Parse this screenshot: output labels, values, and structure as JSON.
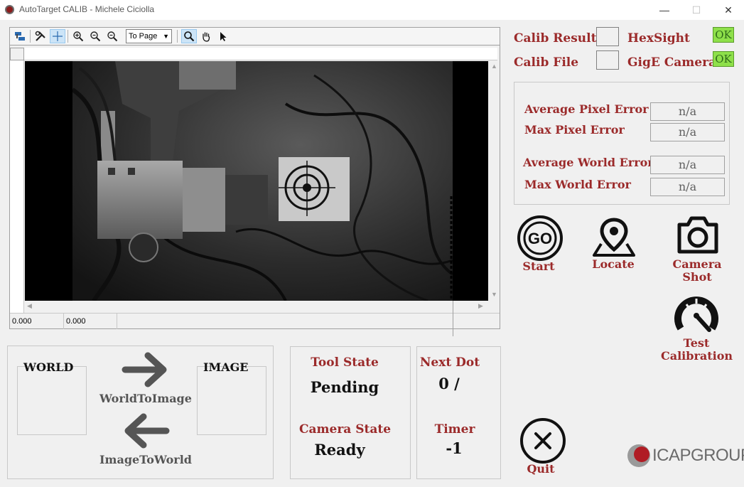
{
  "window": {
    "title": "AutoTarget CALIB - Michele Ciciolla",
    "minimize_glyph": "—",
    "maximize_glyph": "☐",
    "close_glyph": "✕"
  },
  "toolbar": {
    "zoom_mode": "To Page",
    "icons": [
      "layers-icon",
      "tools-icon",
      "crosshair-icon",
      "zoom-fit-icon",
      "zoom-in-icon",
      "zoom-out-icon",
      "magnifier-icon",
      "hand-icon",
      "pointer-icon"
    ]
  },
  "viewer": {
    "status_x": "0.000",
    "status_y": "0.000"
  },
  "status": {
    "calib_result_label": "Calib Result",
    "calib_file_label": "Calib File",
    "hexsight_label": "HexSight",
    "hexsight_value": "OK",
    "gige_label": "GigE Camera",
    "gige_value": "OK",
    "ok_color": "#8ee04a"
  },
  "errors": {
    "avg_pixel_label": "Average Pixel Error",
    "avg_pixel_value": "n/a",
    "max_pixel_label": "Max Pixel Error",
    "max_pixel_value": "n/a",
    "avg_world_label": "Average World Error",
    "avg_world_value": "n/a",
    "max_world_label": "Max World Error",
    "max_world_value": "n/a"
  },
  "actions": {
    "go_icon_text": "GO",
    "start_label": "Start",
    "locate_label": "Locate",
    "camera_shot_label_1": "Camera",
    "camera_shot_label_2": "Shot",
    "test_calibration_label_1": "Test",
    "test_calibration_label_2": "Calibration",
    "quit_label": "Quit"
  },
  "transform": {
    "world_label": "WORLD",
    "image_label": "IMAGE",
    "world_to_image_label": "WorldToImage",
    "image_to_world_label": "ImageToWorld"
  },
  "state": {
    "tool_state_label": "Tool State",
    "tool_state_value": "Pending",
    "camera_state_label": "Camera State",
    "camera_state_value": "Ready",
    "next_dot_label": "Next Dot",
    "next_dot_value": "0 /",
    "timer_label": "Timer",
    "timer_value": "-1"
  },
  "brand": {
    "logo_text": "ICAPGROUP",
    "accent_color": "#9b2a2a"
  }
}
